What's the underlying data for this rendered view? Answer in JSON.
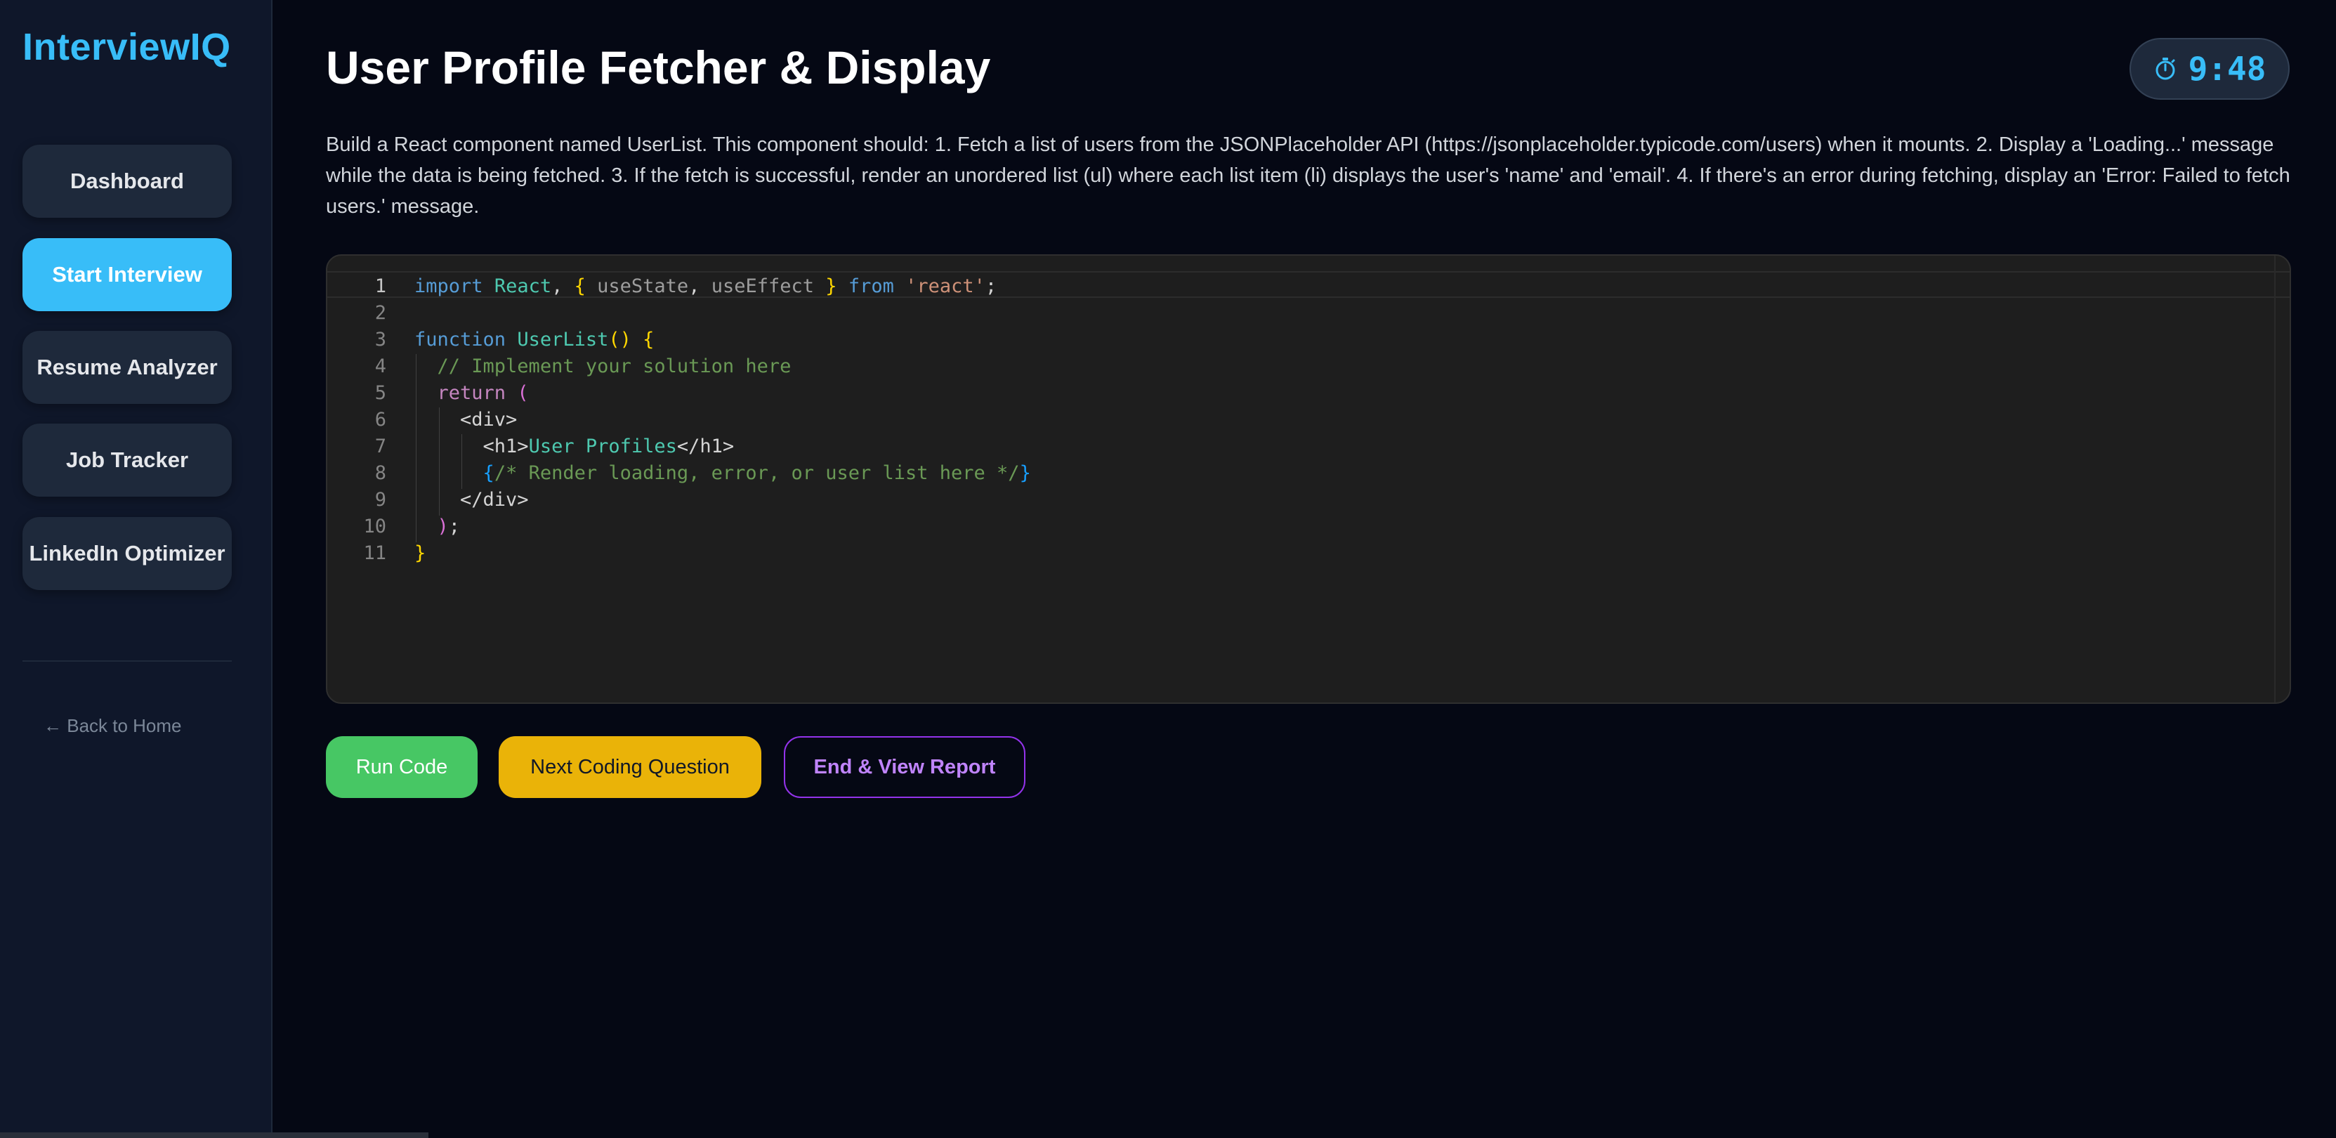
{
  "app": {
    "name": "InterviewIQ"
  },
  "sidebar": {
    "items": [
      {
        "label": "Dashboard",
        "active": false
      },
      {
        "label": "Start Interview",
        "active": true
      },
      {
        "label": "Resume Analyzer",
        "active": false
      },
      {
        "label": "Job Tracker",
        "active": false
      },
      {
        "label": "LinkedIn Optimizer",
        "active": false
      }
    ],
    "back_link": "← Back to Home"
  },
  "header": {
    "title": "User Profile Fetcher & Display",
    "timer": "9:48",
    "timer_icon": "stopwatch-icon"
  },
  "question": {
    "description": "Build a React component named UserList. This component should: 1. Fetch a list of users from the JSONPlaceholder API (https://jsonplaceholder.typicode.com/users) when it mounts. 2. Display a 'Loading...' message while the data is being fetched. 3. If the fetch is successful, render an unordered list (ul) where each list item (li) displays the user's 'name' and 'email'. 4. If there's an error during fetching, display an 'Error: Failed to fetch users.' message."
  },
  "editor": {
    "line_numbers": [
      "1",
      "2",
      "3",
      "4",
      "5",
      "6",
      "7",
      "8",
      "9",
      "10",
      "11"
    ],
    "lines": [
      "import React, { useState, useEffect } from 'react';",
      "",
      "function UserList() {",
      "  // Implement your solution here",
      "  return (",
      "    <div>",
      "      <h1>User Profiles</h1>",
      "      {/* Render loading, error, or user list here */}",
      "    </div>",
      "  );",
      "}"
    ]
  },
  "actions": {
    "run_label": "Run Code",
    "next_label": "Next Coding Question",
    "end_label": "End & View Report"
  },
  "colors": {
    "accent": "#38bdf8",
    "run": "#47c764",
    "next": "#eab308",
    "end_border": "#9333ea",
    "end_text": "#c084fc",
    "background": "#050814",
    "sidebar": "#0f172a"
  }
}
